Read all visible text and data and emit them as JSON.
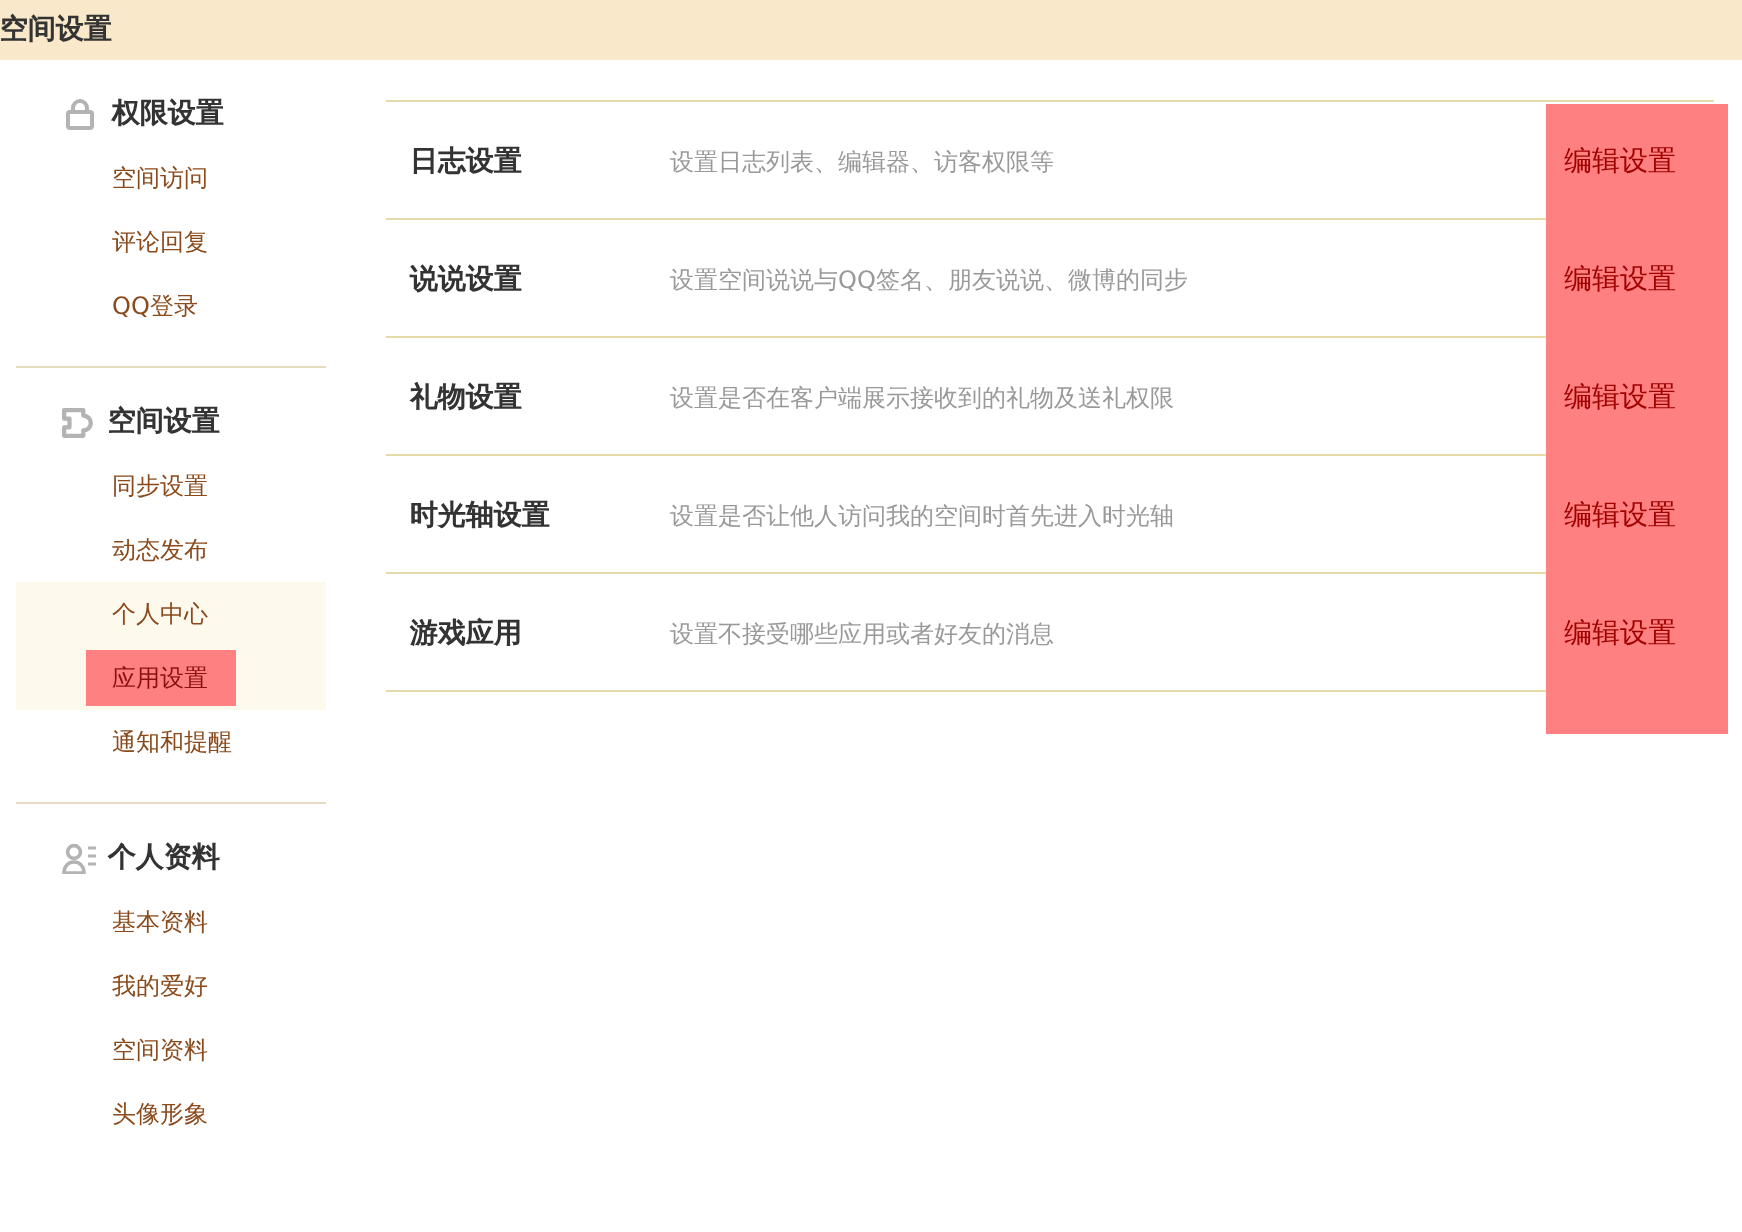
{
  "page_title": "空间设置",
  "sidebar": {
    "groups": [
      {
        "heading": "权限设置",
        "items": [
          {
            "label": "空间访问",
            "selected": false,
            "shaded": false
          },
          {
            "label": "评论回复",
            "selected": false,
            "shaded": false
          },
          {
            "label": "QQ登录",
            "selected": false,
            "shaded": false
          }
        ]
      },
      {
        "heading": "空间设置",
        "items": [
          {
            "label": "同步设置",
            "selected": false,
            "shaded": false
          },
          {
            "label": "动态发布",
            "selected": false,
            "shaded": false
          },
          {
            "label": "个人中心",
            "selected": false,
            "shaded": true
          },
          {
            "label": "应用设置",
            "selected": true,
            "shaded": true
          },
          {
            "label": "通知和提醒",
            "selected": false,
            "shaded": false
          }
        ]
      },
      {
        "heading": "个人资料",
        "items": [
          {
            "label": "基本资料",
            "selected": false,
            "shaded": false
          },
          {
            "label": "我的爱好",
            "selected": false,
            "shaded": false
          },
          {
            "label": "空间资料",
            "selected": false,
            "shaded": false
          },
          {
            "label": "头像形象",
            "selected": false,
            "shaded": false
          }
        ]
      }
    ]
  },
  "settings": {
    "edit_column_highlighted": true,
    "rows": [
      {
        "title": "日志设置",
        "description": "设置日志列表、编辑器、访客权限等",
        "action": "编辑设置"
      },
      {
        "title": "说说设置",
        "description": "设置空间说说与QQ签名、朋友说说、微博的同步",
        "action": "编辑设置"
      },
      {
        "title": "礼物设置",
        "description": "设置是否在客户端展示接收到的礼物及送礼权限",
        "action": "编辑设置"
      },
      {
        "title": "时光轴设置",
        "description": "设置是否让他人访问我的空间时首先进入时光轴",
        "action": "编辑设置"
      },
      {
        "title": "游戏应用",
        "description": "设置不接受哪些应用或者好友的消息",
        "action": "编辑设置"
      }
    ]
  }
}
